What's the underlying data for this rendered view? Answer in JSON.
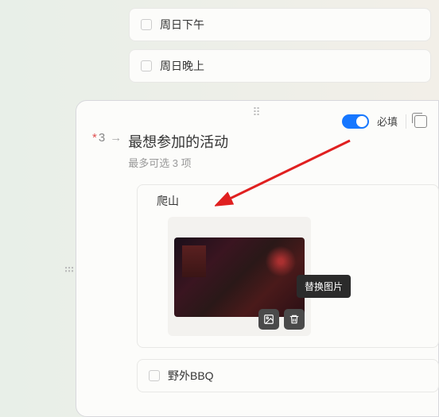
{
  "top_options": [
    {
      "label": "周日下午"
    },
    {
      "label": "周日晚上"
    }
  ],
  "question": {
    "number": "3",
    "asterisk": "*",
    "arrow": "→",
    "title": "最想参加的活动",
    "subtitle": "最多可选 3 项",
    "required_label": "必填"
  },
  "options": [
    {
      "label": "爬山",
      "has_image": true
    },
    {
      "label": "野外BBQ",
      "has_image": false
    }
  ],
  "image_tooltip": "替换图片",
  "icons": {
    "replace": "replace-image-icon",
    "delete": "trash-icon"
  }
}
